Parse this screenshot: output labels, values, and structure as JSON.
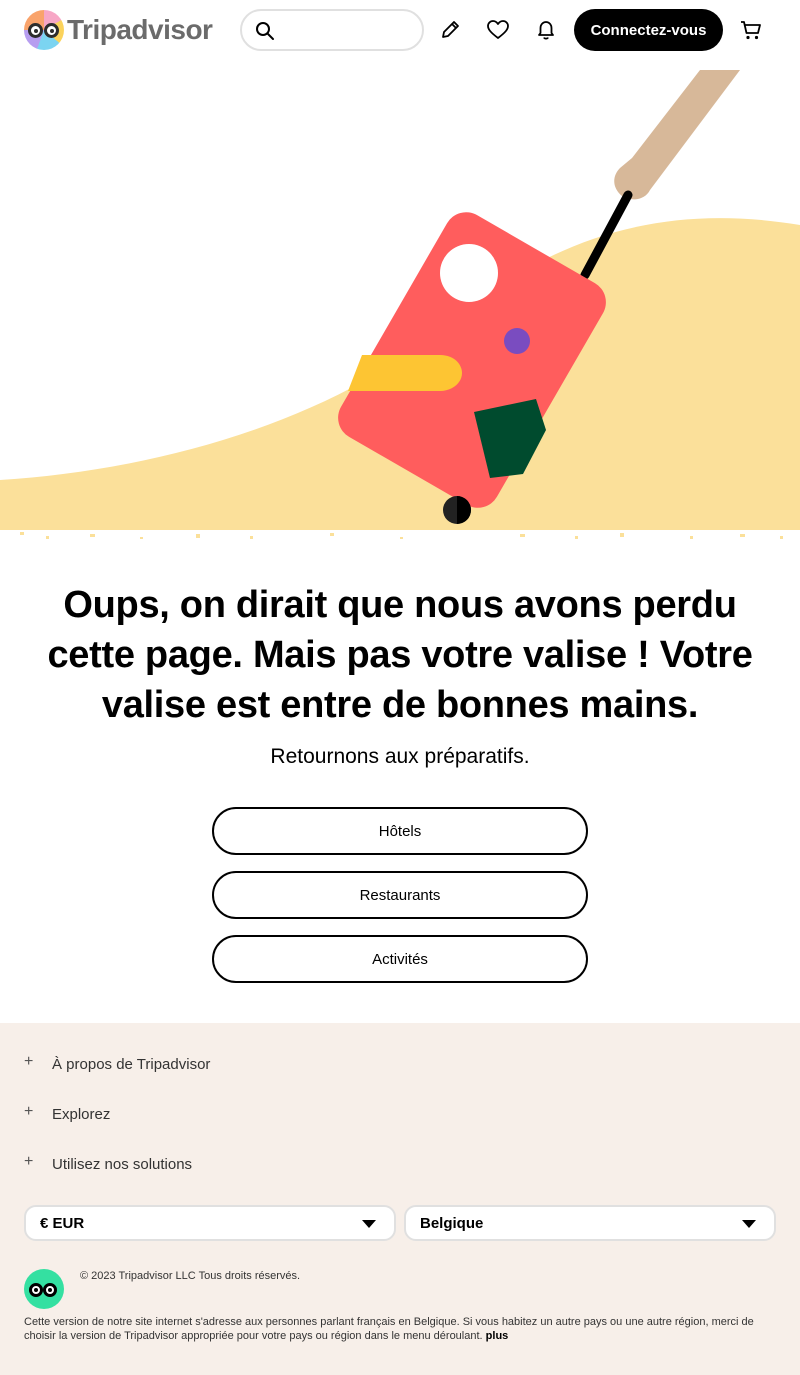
{
  "header": {
    "brand": "Tripadvisor",
    "search": {
      "value": "",
      "placeholder": ""
    },
    "icons": [
      "pencil-icon",
      "heart-icon",
      "bell-icon",
      "cart-icon"
    ],
    "signin_label": "Connectez-vous"
  },
  "error": {
    "headline": "Oups, on dirait que nous avons perdu cette page. Mais pas votre valise ! Votre valise est entre de bonnes mains.",
    "subline": "Retournons aux préparatifs."
  },
  "nav_buttons": [
    {
      "label": "Hôtels"
    },
    {
      "label": "Restaurants"
    },
    {
      "label": "Activités"
    }
  ],
  "footer": {
    "sections": [
      {
        "label": "À propos de Tripadvisor"
      },
      {
        "label": "Explorez"
      },
      {
        "label": "Utilisez nos solutions"
      }
    ],
    "currency": "€ EUR",
    "region": "Belgique",
    "copyright": "© 2023 Tripadvisor LLC Tous droits réservés.",
    "disclaimer": "Cette version de notre site internet s'adresse aux personnes parlant français en Belgique. Si vous habitez un autre pays ou une autre région, merci de choisir la version de Tripadvisor appropriée pour votre pays ou région dans le menu déroulant.",
    "more_label": "plus"
  },
  "colors": {
    "sand": "#fbe09a",
    "suitcase": "#ff5d5d",
    "brand_green": "#34e0a1",
    "footer_bg": "#f7efe9"
  }
}
